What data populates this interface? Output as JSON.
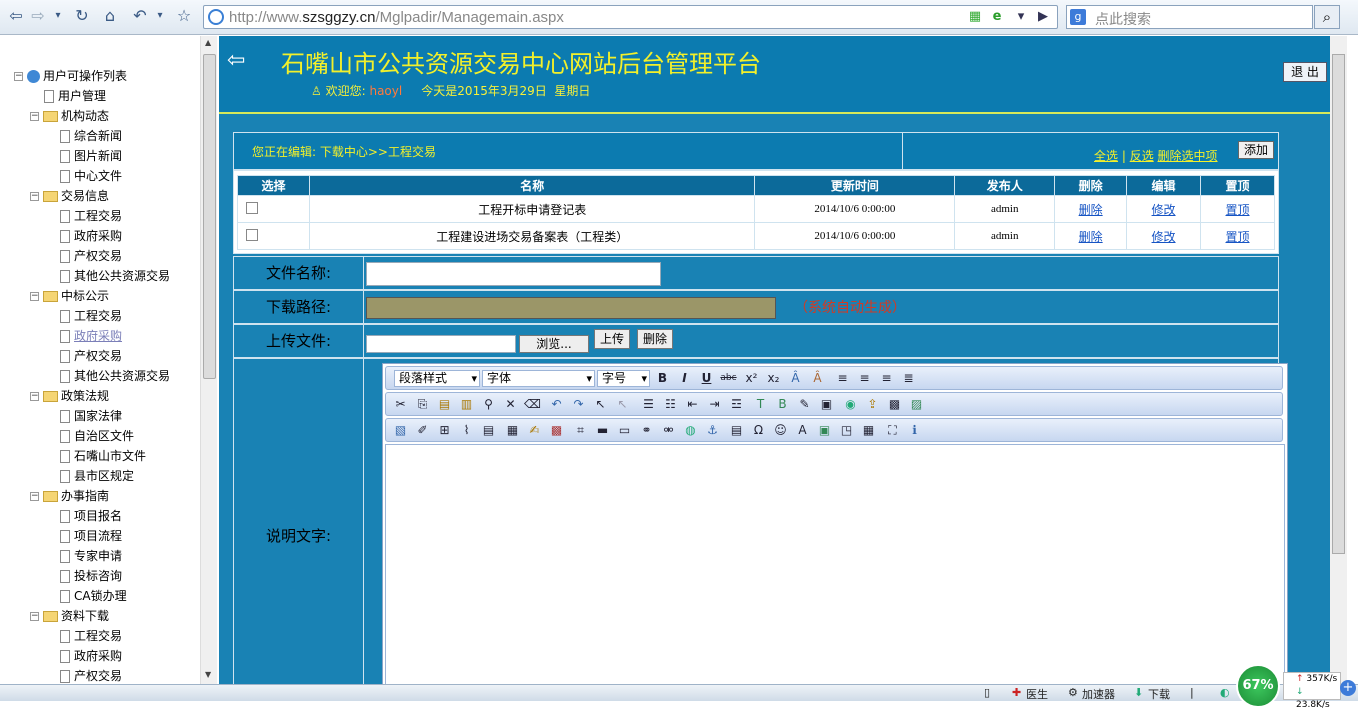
{
  "browser": {
    "address": "http://www.szsggzy.cn/Mglpadir/Managemain.aspx",
    "address_domain": "szsggzy.cn",
    "address_prefix": "http://www.",
    "address_path": "/Mglpadir/Managemain.aspx",
    "search_placeholder": "点此搜索"
  },
  "sidebar": {
    "root": "用户可操作列表",
    "nodes": [
      {
        "label": "用户管理",
        "type": "doc",
        "level": 1
      },
      {
        "label": "机构动态",
        "type": "folder",
        "level": 1
      },
      {
        "label": "综合新闻",
        "type": "doc",
        "level": 2
      },
      {
        "label": "图片新闻",
        "type": "doc",
        "level": 2
      },
      {
        "label": "中心文件",
        "type": "doc",
        "level": 2
      },
      {
        "label": "交易信息",
        "type": "folder",
        "level": 1
      },
      {
        "label": "工程交易",
        "type": "doc",
        "level": 2
      },
      {
        "label": "政府采购",
        "type": "doc",
        "level": 2
      },
      {
        "label": "产权交易",
        "type": "doc",
        "level": 2
      },
      {
        "label": "其他公共资源交易",
        "type": "doc",
        "level": 2
      },
      {
        "label": "中标公示",
        "type": "folder",
        "level": 1
      },
      {
        "label": "工程交易",
        "type": "doc",
        "level": 2
      },
      {
        "label": "政府采购",
        "type": "doc",
        "level": 2,
        "visited": true
      },
      {
        "label": "产权交易",
        "type": "doc",
        "level": 2
      },
      {
        "label": "其他公共资源交易",
        "type": "doc",
        "level": 2
      },
      {
        "label": "政策法规",
        "type": "folder",
        "level": 1
      },
      {
        "label": "国家法律",
        "type": "doc",
        "level": 2
      },
      {
        "label": "自治区文件",
        "type": "doc",
        "level": 2
      },
      {
        "label": "石嘴山市文件",
        "type": "doc",
        "level": 2
      },
      {
        "label": "县市区规定",
        "type": "doc",
        "level": 2
      },
      {
        "label": "办事指南",
        "type": "folder",
        "level": 1
      },
      {
        "label": "项目报名",
        "type": "doc",
        "level": 2
      },
      {
        "label": "项目流程",
        "type": "doc",
        "level": 2
      },
      {
        "label": "专家申请",
        "type": "doc",
        "level": 2
      },
      {
        "label": "投标咨询",
        "type": "doc",
        "level": 2
      },
      {
        "label": "CA锁办理",
        "type": "doc",
        "level": 2
      },
      {
        "label": "资料下载",
        "type": "folder",
        "level": 1
      },
      {
        "label": "工程交易",
        "type": "doc",
        "level": 2
      },
      {
        "label": "政府采购",
        "type": "doc",
        "level": 2
      },
      {
        "label": "产权交易",
        "type": "doc",
        "level": 2
      }
    ]
  },
  "header": {
    "title": "石嘴山市公共资源交易中心网站后台管理平台",
    "welcome_label": "欢迎您:",
    "username": "haoyl",
    "date_text": "今天是2015年3月29日",
    "weekday": "星期日",
    "logout": "退 出"
  },
  "bar": {
    "editing": "您正在编辑: 下载中心>>工程交易",
    "select_all": "全选",
    "invert": "反选",
    "delete_selected": "删除选中项",
    "add": "添加"
  },
  "grid": {
    "headers": [
      "选择",
      "名称",
      "更新时间",
      "发布人",
      "删除",
      "编辑",
      "置顶"
    ],
    "rows": [
      {
        "name": "工程开标申请登记表",
        "time": "2014/10/6 0:00:00",
        "publisher": "admin",
        "delete": "删除",
        "edit": "修改",
        "top": "置顶"
      },
      {
        "name": "工程建设进场交易备案表（工程类）",
        "time": "2014/10/6 0:00:00",
        "publisher": "admin",
        "delete": "删除",
        "edit": "修改",
        "top": "置顶"
      }
    ]
  },
  "form": {
    "filename_label": "文件名称:",
    "filename_value": "",
    "path_label": "下载路径:",
    "path_value": "",
    "path_note": "（系统自动生成）",
    "upload_label": "上传文件:",
    "browse": "浏览...",
    "upload_btn": "上传",
    "delete_btn": "删除",
    "desc_label": "说明文字:"
  },
  "editor": {
    "paragraph_style": "段落样式",
    "font": "字体",
    "font_size": "字号"
  },
  "taskbar": {
    "doctor": "医生",
    "accelerator": "加速器",
    "download": "下载",
    "memory": "67%",
    "up_speed": "357K/s",
    "down_speed": "23.8K/s"
  }
}
